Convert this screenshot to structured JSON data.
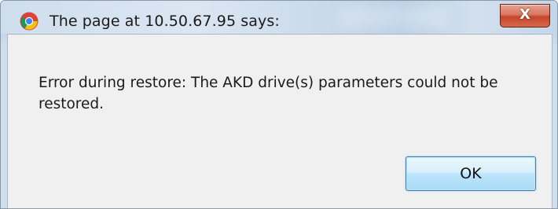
{
  "dialog": {
    "title": "The page at 10.50.67.95 says:",
    "close_label": "X",
    "message": "Error during restore: The AKD drive(s) parameters could not be restored.",
    "ok_label": "OK",
    "app_icon": "chrome-icon"
  },
  "colors": {
    "close_button": "#c6452a",
    "ok_button_border": "#3c7fb1",
    "client_background": "#f0f0f0"
  }
}
